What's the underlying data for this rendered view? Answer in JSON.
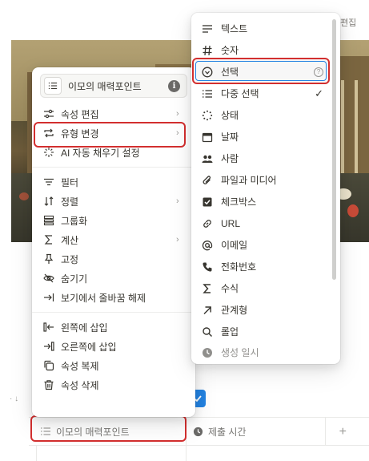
{
  "top_right_edit": "편집",
  "left_menu": {
    "property_name_value": "이모의 매력포인트",
    "info_icon": "i",
    "items": [
      {
        "label": "속성 편집",
        "icon": "sliders-icon",
        "has_submenu": true
      },
      {
        "label": "유형 변경",
        "icon": "swap-icon",
        "has_submenu": true
      },
      {
        "label": "AI 자동 채우기 설정",
        "icon": "sparkle-icon",
        "has_submenu": false
      },
      {
        "label": "필터",
        "icon": "filter-icon",
        "has_submenu": false
      },
      {
        "label": "정렬",
        "icon": "sort-icon",
        "has_submenu": true
      },
      {
        "label": "그룹화",
        "icon": "group-icon",
        "has_submenu": false
      },
      {
        "label": "계산",
        "icon": "sigma-icon",
        "has_submenu": true
      },
      {
        "label": "고정",
        "icon": "pin-icon",
        "has_submenu": false
      },
      {
        "label": "숨기기",
        "icon": "eye-off-icon",
        "has_submenu": false
      },
      {
        "label": "보기에서 줄바꿈 해제",
        "icon": "unwrap-icon",
        "has_submenu": false
      },
      {
        "label": "왼쪽에 삽입",
        "icon": "insert-left-icon",
        "has_submenu": false
      },
      {
        "label": "오른쪽에 삽입",
        "icon": "insert-right-icon",
        "has_submenu": false
      },
      {
        "label": "속성 복제",
        "icon": "duplicate-icon",
        "has_submenu": false
      },
      {
        "label": "속성 삭제",
        "icon": "trash-icon",
        "has_submenu": false
      }
    ]
  },
  "type_menu": {
    "items": [
      {
        "label": "텍스트",
        "icon": "text-icon"
      },
      {
        "label": "숫자",
        "icon": "hash-icon"
      },
      {
        "label": "선택",
        "icon": "select-icon",
        "trailing": "question-icon"
      },
      {
        "label": "다중 선택",
        "icon": "multi-select-icon",
        "trailing": "checkmark"
      },
      {
        "label": "상태",
        "icon": "status-icon"
      },
      {
        "label": "날짜",
        "icon": "calendar-icon"
      },
      {
        "label": "사람",
        "icon": "people-icon"
      },
      {
        "label": "파일과 미디어",
        "icon": "paperclip-icon"
      },
      {
        "label": "체크박스",
        "icon": "checkbox-icon"
      },
      {
        "label": "URL",
        "icon": "link-icon"
      },
      {
        "label": "이메일",
        "icon": "at-icon"
      },
      {
        "label": "전화번호",
        "icon": "phone-icon"
      },
      {
        "label": "수식",
        "icon": "formula-icon"
      },
      {
        "label": "관계형",
        "icon": "relation-icon"
      },
      {
        "label": "롤업",
        "icon": "rollup-icon"
      },
      {
        "label": "생성 일시",
        "icon": "clock-icon"
      }
    ],
    "question_mark": "?",
    "check_mark": "✓"
  },
  "table_header": {
    "columns": [
      {
        "label": "이모의 매력포인트",
        "icon": "list-icon"
      },
      {
        "label": "제출 시간",
        "icon": "clock-icon"
      }
    ],
    "add_column": "+"
  },
  "left_edge_glyph": "· ↓"
}
